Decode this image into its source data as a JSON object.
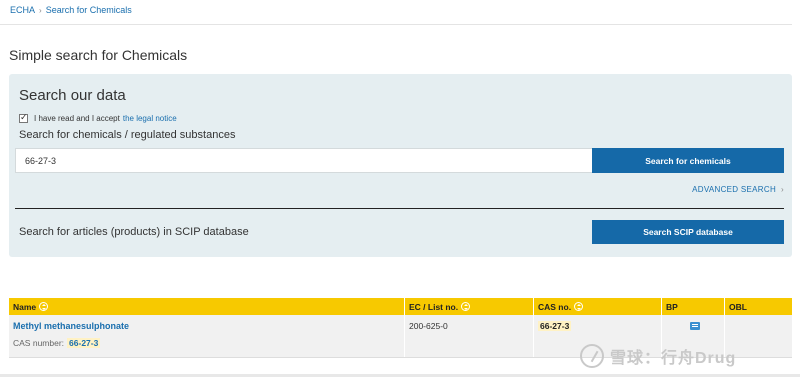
{
  "breadcrumb": {
    "items": [
      "ECHA",
      "Search for Chemicals"
    ],
    "separator": "›"
  },
  "page": {
    "title": "Simple search for Chemicals"
  },
  "search_panel": {
    "title": "Search our data",
    "legal": {
      "checked": true,
      "text": "I have read and I accept",
      "link": "the legal notice"
    },
    "search_label": "Search for chemicals / regulated substances",
    "search_value": "66-27-3",
    "search_button": "Search for chemicals",
    "advanced_search": "ADVANCED SEARCH",
    "scip_label": "Search for articles (products) in SCIP database",
    "scip_button": "Search SCIP database"
  },
  "results": {
    "headers": {
      "name": "Name",
      "ec": "EC / List no.",
      "cas": "CAS no.",
      "bp": "BP",
      "obl": "OBL"
    },
    "rows": [
      {
        "name": "Methyl methanesulphonate",
        "cas_label": "CAS number:",
        "cas_value": "66-27-3",
        "ec": "200-625-0",
        "cas": "66-27-3",
        "bp_icon": "document-icon",
        "obl": ""
      }
    ]
  },
  "watermark": {
    "text": "雪球：行舟Drug"
  },
  "colors": {
    "accent_blue": "#1569a8",
    "link_blue": "#1a6fae",
    "table_header": "#f7c900",
    "panel_bg": "#e5eef1",
    "highlight": "#fff2c4"
  }
}
